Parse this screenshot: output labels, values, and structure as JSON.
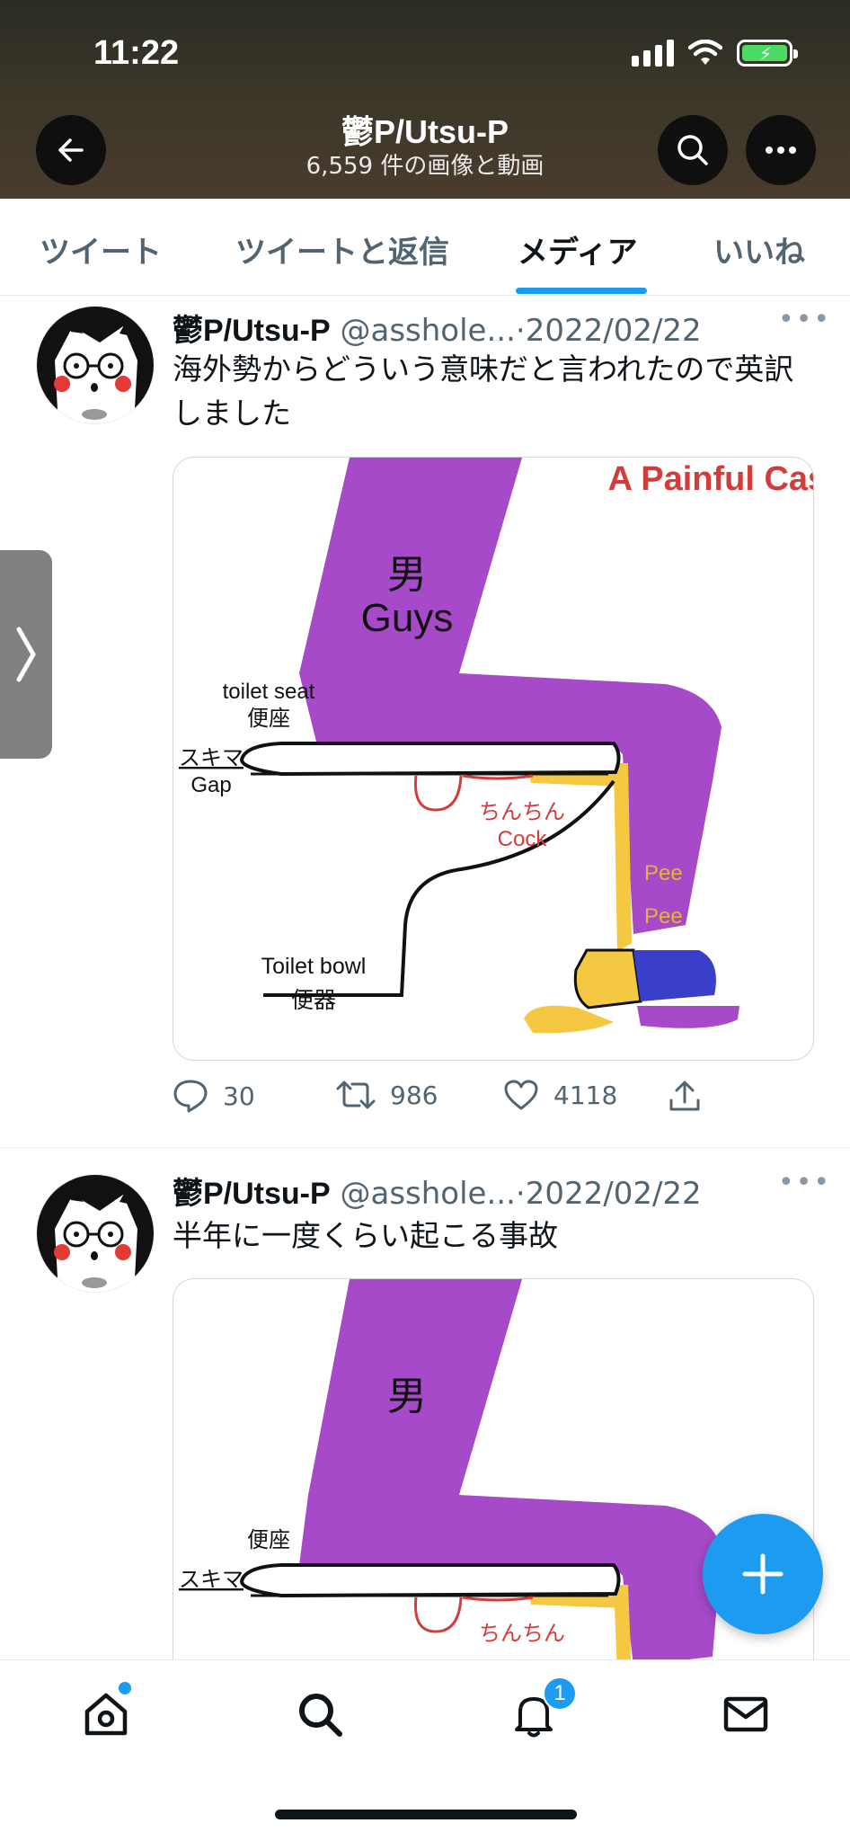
{
  "status_bar": {
    "time": "11:22"
  },
  "header": {
    "title": "鬱P/Utsu-P",
    "subtitle": "6,559 件の画像と動画"
  },
  "tabs": [
    {
      "label": "ツイート",
      "active": false
    },
    {
      "label": "ツイートと返信",
      "active": false
    },
    {
      "label": "メディア",
      "active": true
    },
    {
      "label": "いいね",
      "active": false
    }
  ],
  "tweets": [
    {
      "name": "鬱P/Utsu-P",
      "handle": "@asshole...",
      "separator": "·",
      "date": "2022/02/22",
      "text": "海外勢からどういう意味だと言われたので英訳しました",
      "image": {
        "title": "A Painful Case",
        "labels": {
          "man_jp": "男",
          "man_en": "Guys",
          "seat_en": "toilet seat",
          "seat_jp": "便座",
          "gap_jp": "スキマ",
          "gap_en": "Gap",
          "cock_jp": "ちんちん",
          "cock_en": "Cock",
          "pee1": "Pee",
          "pee2": "Pee",
          "bowl_en": "Toilet bowl",
          "bowl_jp": "便器"
        }
      },
      "replies": "30",
      "retweets": "986",
      "likes": "4118"
    },
    {
      "name": "鬱P/Utsu-P",
      "handle": "@asshole...",
      "separator": "·",
      "date": "2022/02/22",
      "text": "半年に一度くらい起こる事故",
      "image": {
        "labels": {
          "man_jp": "男",
          "seat_jp": "便座",
          "gap_jp": "スキマ",
          "cock_jp": "ちんちん"
        }
      }
    }
  ],
  "bottom_nav": {
    "items": [
      "home-icon",
      "search-icon",
      "bell-icon",
      "mail-icon"
    ],
    "notification_count": "1"
  },
  "colors": {
    "accent": "#1d9bf0",
    "purple": "#a64ac9",
    "yellow": "#f5c842",
    "blue": "#3a3fc9",
    "red_text": "#d43c3c"
  }
}
